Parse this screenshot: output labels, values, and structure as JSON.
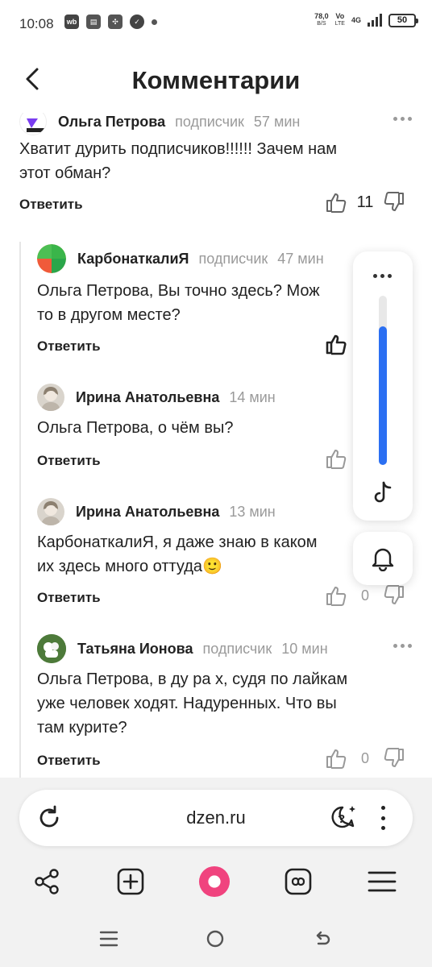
{
  "status_bar": {
    "time": "10:08",
    "speed_value": "78,0",
    "speed_unit": "B/S",
    "network_vo": "Vo",
    "network_lte": "LTE",
    "network_4g": "4G",
    "battery": "50"
  },
  "header": {
    "title": "Комментарии"
  },
  "comments": [
    {
      "author": "Ольга Петрова",
      "tag": "подписчик",
      "time": "57 мин",
      "text": "Хватит дурить подписчиков!!!!!! Зачем нам\nэтот обман?",
      "reply_label": "Ответить",
      "likes": "11"
    },
    {
      "author": "КарбонаткалиЯ",
      "tag": "подписчик",
      "time": "47 мин",
      "text": "Ольга Петрова, Вы точно здесь? Мож\nто в другом месте?",
      "reply_label": "Ответить",
      "likes": ""
    },
    {
      "author": "Ирина Анатольевна",
      "tag": "",
      "time": "14 мин",
      "text": "Ольга Петрова, о чём вы?",
      "reply_label": "Ответить",
      "likes": ""
    },
    {
      "author": "Ирина Анатольевна",
      "tag": "",
      "time": "13 мин",
      "text": "КарбонаткалиЯ, я даже знаю в каком\nих здесь много оттуда🙂",
      "reply_label": "Ответить",
      "likes": "0"
    },
    {
      "author": "Татьяна Ионова",
      "tag": "подписчик",
      "time": "10 мин",
      "text": "Ольга Петрова, в ду ра х, судя по лайкам\nуже  человек ходят. Надуренных. Что вы\nтам курите?",
      "reply_label": "Ответить",
      "likes": "0"
    }
  ],
  "player": {
    "volume_level": 0.82
  },
  "browser": {
    "url": "dzen.ru"
  },
  "colors": {
    "accent_blue": "#2b6ff2",
    "alice_pink": "#f0437e",
    "muted_text": "#9a9a9a"
  }
}
